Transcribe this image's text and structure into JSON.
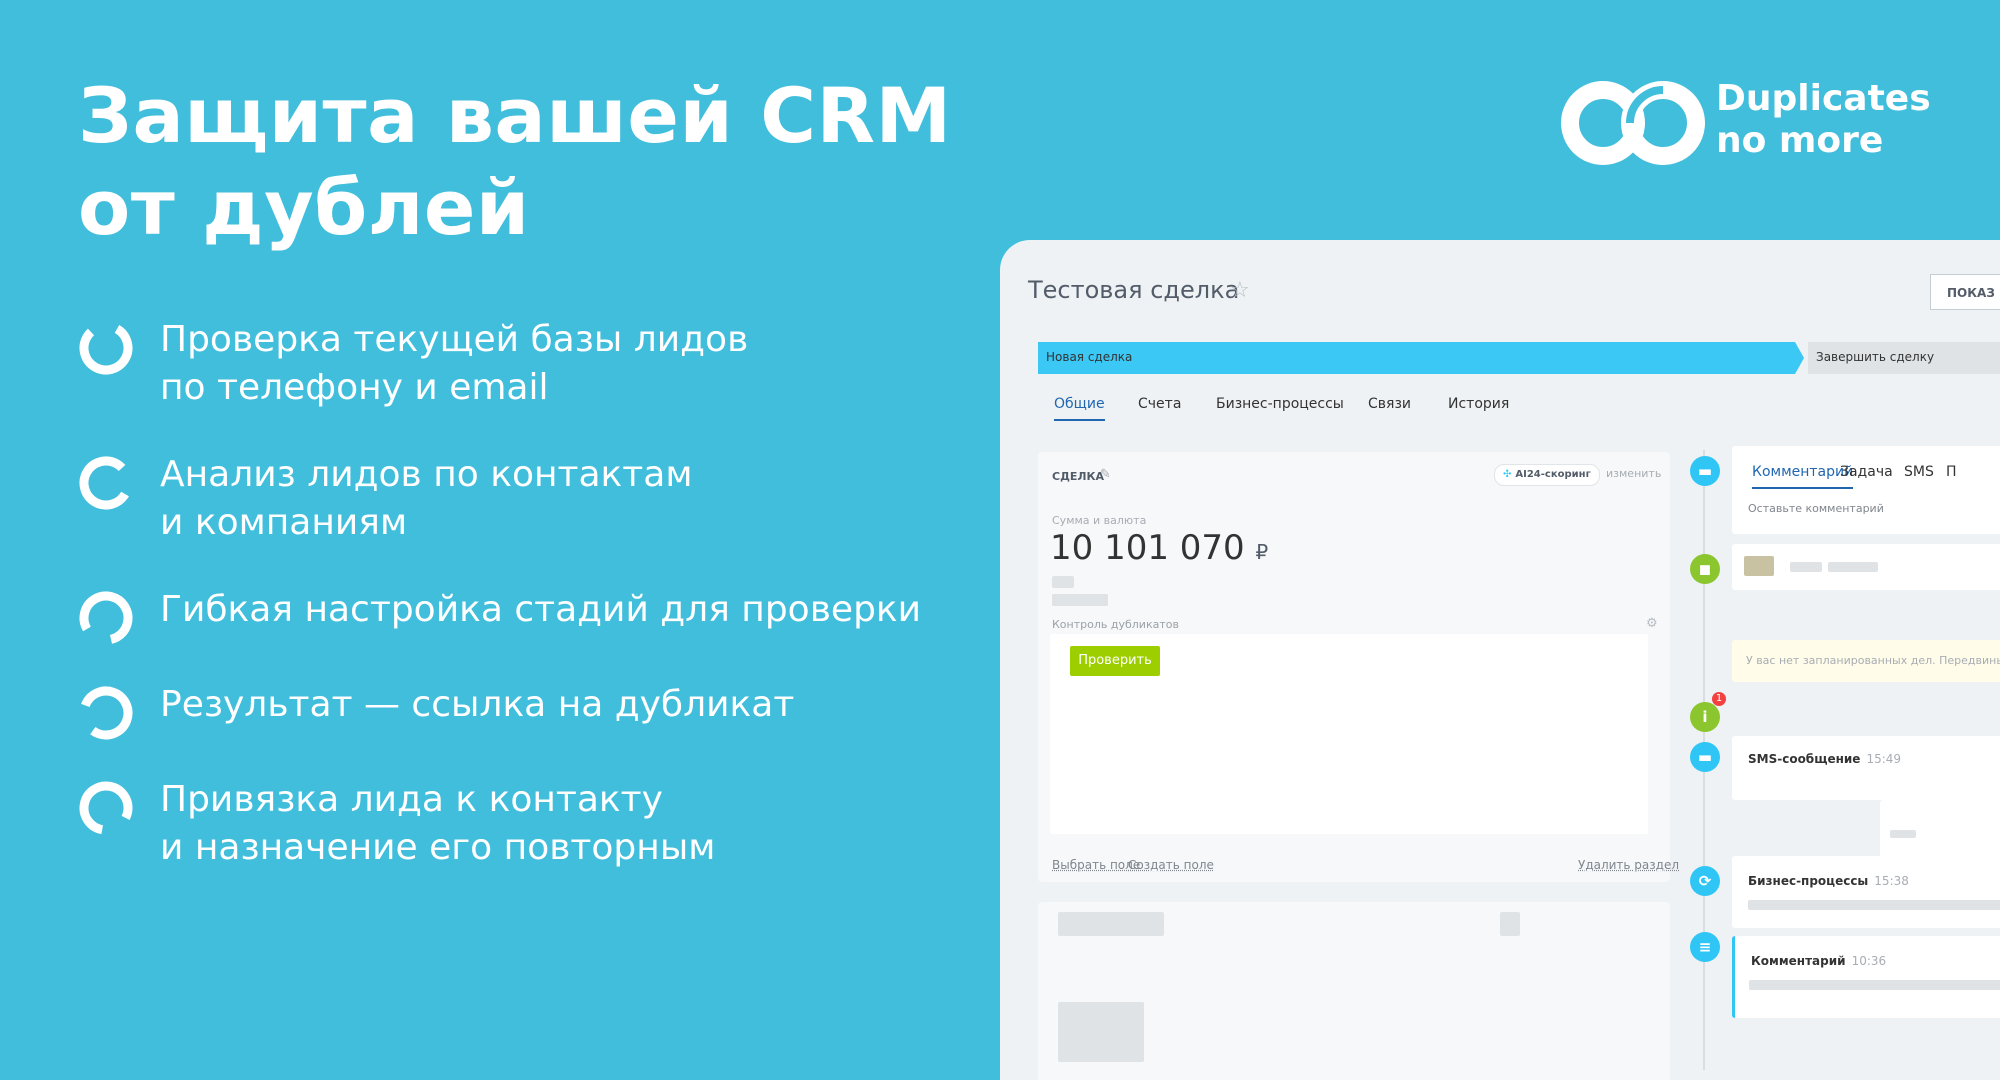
{
  "headline": {
    "line1": "Защита вашей CRM",
    "line2": "от дублей"
  },
  "brand": {
    "line1": "Duplicates",
    "line2": "no more",
    "logo_icon": "interlocked-rings-logo"
  },
  "features": [
    {
      "line1": "Проверка текущей базы лидов",
      "line2": "по телефону и email",
      "icon": "ring-icon"
    },
    {
      "line1": "Анализ лидов по контактам",
      "line2": "и компаниям",
      "icon": "ring-icon"
    },
    {
      "line1": "Гибкая настройка стадий для проверки",
      "line2": "",
      "icon": "ring-icon"
    },
    {
      "line1": "Результат — ссылка на дубликат",
      "line2": "",
      "icon": "ring-icon"
    },
    {
      "line1": "Привязка лида к контакту",
      "line2": "и назначение его повторным",
      "icon": "ring-icon"
    }
  ],
  "crm": {
    "deal_title": "Тестовая сделка",
    "show_button": "ПОКАЗ",
    "stages": {
      "current": "Новая сделка",
      "finish": "Завершить сделку"
    },
    "tabs": [
      "Общие",
      "Счета",
      "Бизнес-процессы",
      "Связи",
      "История"
    ],
    "card": {
      "heading": "СДЕЛКА",
      "ai_badge": "AI24-скоринг",
      "change": "изменить",
      "sum_label": "Сумма и валюта",
      "sum_value": "10 101 070",
      "currency": "₽",
      "duplicates_label": "Контроль дубликатов",
      "check_button": "Проверить",
      "select_field": "Выбрать поле",
      "create_field": "Создать поле",
      "delete_section": "Удалить раздел"
    },
    "activity": {
      "tabs": [
        "Комментарий",
        "Задача",
        "SMS",
        "П"
      ],
      "placeholder": "Оставьте комментарий",
      "notice": "У вас нет запланированных дел. Передвиньте",
      "notice_badge": "1",
      "items": [
        {
          "title": "SMS-сообщение",
          "time": "15:49"
        },
        {
          "title": "Бизнес-процессы",
          "time": "15:38"
        },
        {
          "title": "Комментарий",
          "time": "10:36"
        }
      ]
    }
  },
  "colors": {
    "background": "#41bedb",
    "stage_active": "#3bc8f5",
    "check_button": "#9dcf00",
    "link_blue": "#2067b0"
  }
}
